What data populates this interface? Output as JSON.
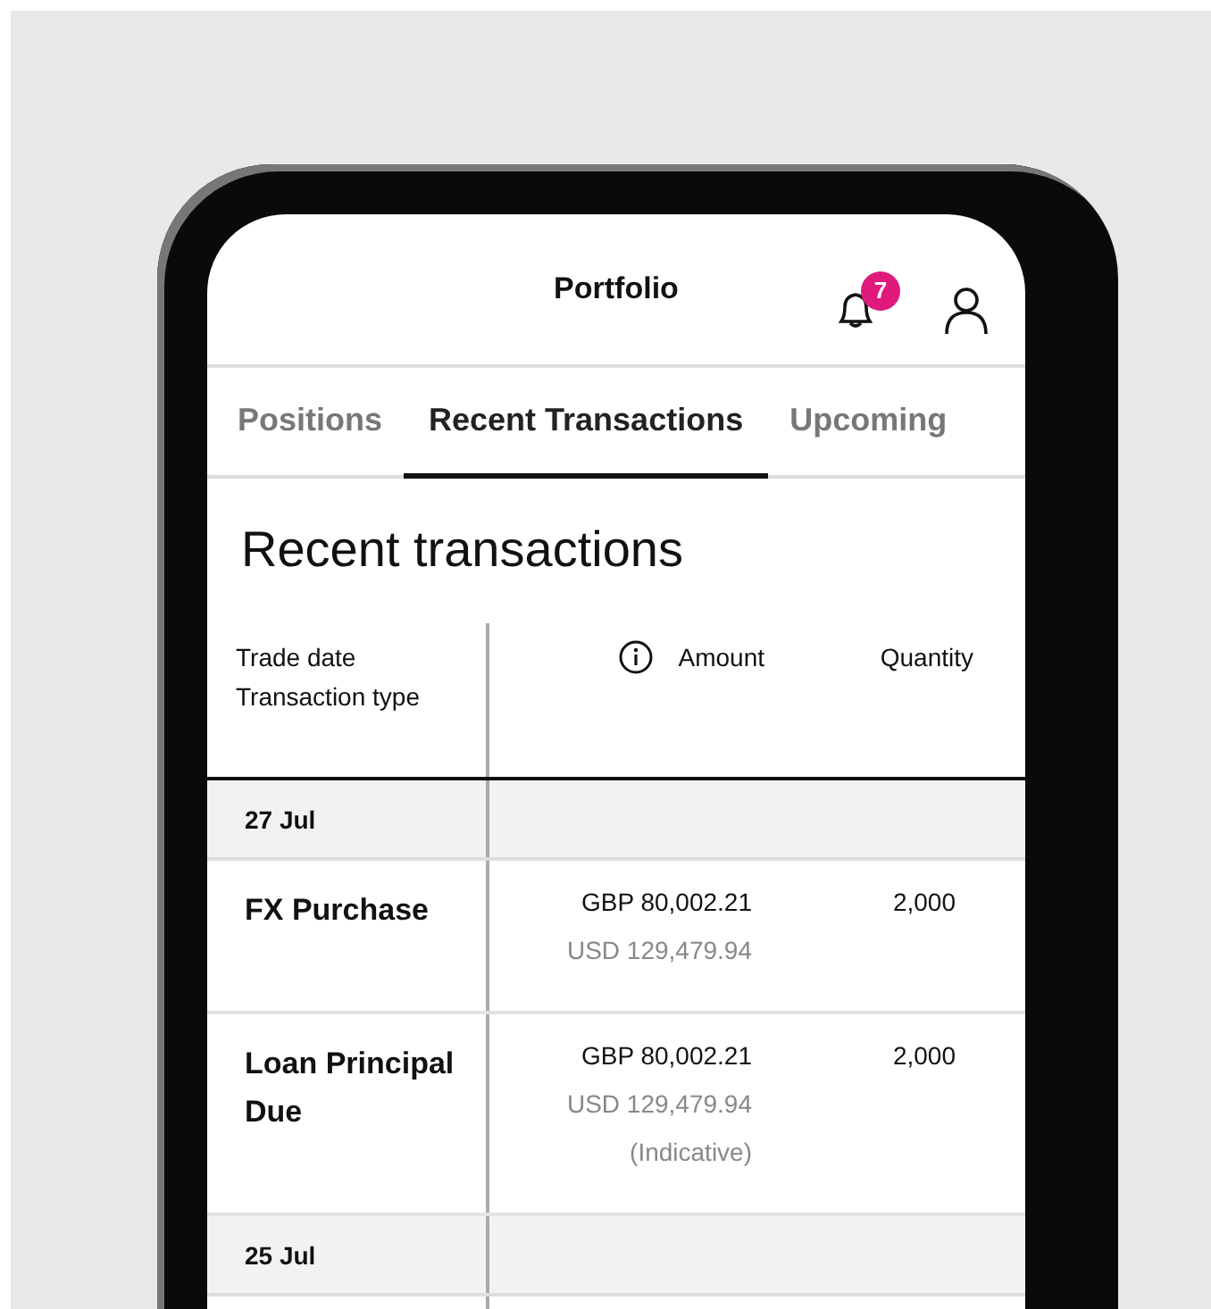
{
  "header": {
    "title": "Portfolio",
    "notification_count": "7"
  },
  "tabs": [
    {
      "label": "Positions",
      "selected": false
    },
    {
      "label": "Recent Transactions",
      "selected": true
    },
    {
      "label": "Upcoming",
      "selected": false
    }
  ],
  "heading": "Recent transactions",
  "table": {
    "columns": [
      {
        "lines": [
          "Trade date",
          "Transaction type"
        ],
        "info": false
      },
      {
        "lines": [
          "Amount"
        ],
        "info": true
      },
      {
        "lines": [
          "Quantity"
        ],
        "info": false
      }
    ],
    "groups": [
      {
        "date": "27 Jul",
        "rows": [
          {
            "type": "FX Purchase",
            "amount": "GBP 80,002.21",
            "converted": "USD 129,479.94",
            "quantity": "2,000"
          },
          {
            "type": "Loan Principal Due",
            "amount": "GBP 80,002.21",
            "converted": "USD 129,479.94",
            "note": "(Indicative)",
            "quantity": "2,000"
          }
        ]
      },
      {
        "date": "25 Jul"
      }
    ]
  }
}
